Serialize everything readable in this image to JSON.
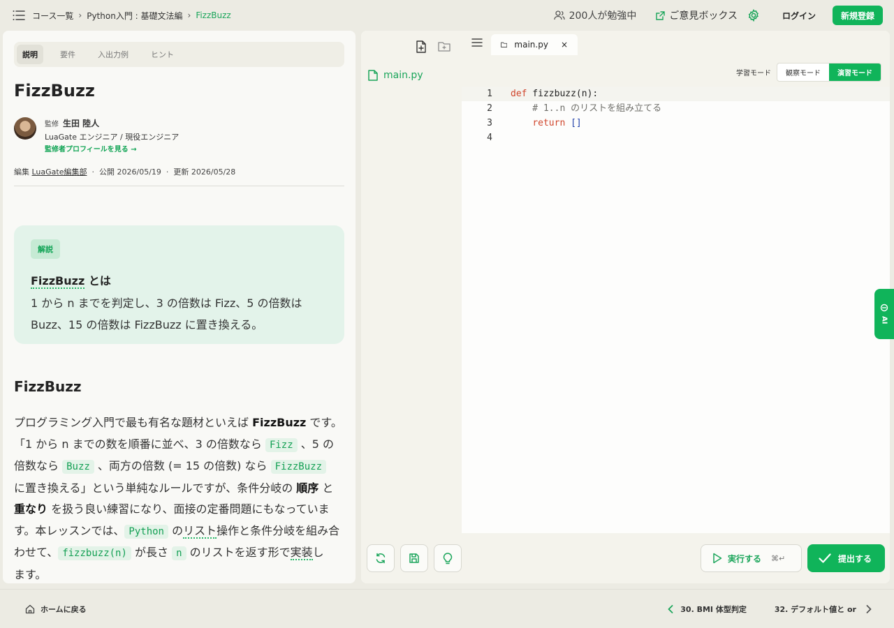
{
  "breadcrumb": {
    "items": [
      "コース一覧",
      "Python入門 : 基礎文法編",
      "FizzBuzz"
    ]
  },
  "header": {
    "studying": "200人が勉強中",
    "feedback": "ご意見ボックス",
    "login": "ログイン",
    "signup": "新規登録"
  },
  "left_tabs": [
    "説明",
    "要件",
    "入出力例",
    "ヒント"
  ],
  "lesson": {
    "title": "FizzBuzz",
    "supervisor_role": "監修",
    "supervisor_name": "生田 陸人",
    "supervisor_title": "LuaGate エンジニア / 現役エンジニア",
    "supervisor_link": "監修者プロフィールを見る →",
    "meta_edit_label": "編集",
    "meta_editor": "LuaGate編集部",
    "meta_dot": "·",
    "meta_published": "公開 2026/05/19",
    "meta_updated": "更新 2026/05/28"
  },
  "callout": {
    "badge": "解説",
    "term": "FizzBuzz",
    "term_suffix": "とは",
    "body_1": "1 から n までを判定し、3 の倍数は Fizz、5 の倍数は",
    "body_2": "Buzz、15 の倍数は FizzBuzz に置き換える。"
  },
  "section": {
    "heading": "FizzBuzz",
    "p1": "プログラミング入門で最も有名な題材といえば ",
    "p1_bold": "FizzBuzz",
    "p1_end": " です。",
    "p2": "「1 から n までの数を順番に並べ、3 の倍数なら ",
    "chip_fizz": "Fizz",
    "p2b": " 、5 の",
    "p3": "倍数なら ",
    "chip_buzz": "Buzz",
    "p3b": " 、両方の倍数 (= 15 の倍数) なら ",
    "chip_fizzbuzz": "FizzBuzz",
    "p4": "に置き換える」という単純なルールですが、条件分岐の ",
    "p4_bold": "順序",
    "p4_end": " と",
    "p5_bold": "重なり",
    "p5": " を扱う良い練習になり、面接の定番問題にもなっていま",
    "p6": "す。本レッスンでは、",
    "chip_python": "Python",
    "p6b": " の",
    "p6_dots": "リスト",
    "p6c": "操作と条件分岐を組み合",
    "p7": "わせて、",
    "chip_fn": "fizzbuzz(n)",
    "p7b": " が長さ ",
    "chip_n": "n",
    "p7c": " のリストを返す形で",
    "p7_dots": "実装",
    "p7d": "し",
    "p8": "ます。"
  },
  "editor": {
    "tree_file": "main.py",
    "tab_file": "main.py",
    "tab_close": "×",
    "mode_label": "学習モード",
    "mode_watch": "観察モード",
    "mode_practice": "演習モード",
    "lines": [
      {
        "n": "1",
        "code_kw": "def",
        "code_rest": " fizzbuzz(n):"
      },
      {
        "n": "2",
        "code_comment": "    # 1..n のリストを組み立てる"
      },
      {
        "n": "3",
        "code_kw_indent": "    ",
        "code_kw": "return",
        "code_br": " []"
      },
      {
        "n": "4"
      }
    ],
    "run": "実行する",
    "run_kbd": "⌘↵",
    "submit": "提出する"
  },
  "ai_tab": "AI",
  "footer": {
    "home": "ホームに戻る",
    "prev": "30. BMI 体型判定",
    "next": "32. デフォルト値と or"
  },
  "colors": {
    "accent": "#10b45a",
    "keyword": "#d0452b",
    "bracket": "#1e3ea8"
  }
}
